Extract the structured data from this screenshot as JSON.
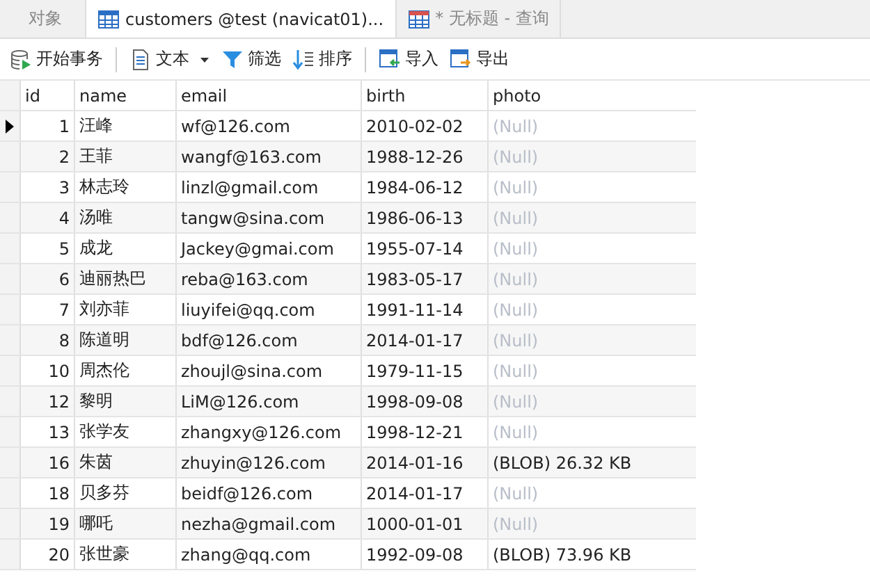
{
  "tabs": [
    {
      "label": "对象",
      "kind": "plain",
      "selected": false
    },
    {
      "label": "customers @test (navicat01)...",
      "kind": "table",
      "selected": true
    },
    {
      "label": "* 无标题 - 查询",
      "kind": "query",
      "selected": false
    }
  ],
  "toolbar": [
    {
      "label": "开始事务",
      "kind": "transaction",
      "dropdown": false
    },
    {
      "label": "文本",
      "kind": "text",
      "dropdown": true
    },
    {
      "label": "筛选",
      "kind": "filter",
      "dropdown": false
    },
    {
      "label": "排序",
      "kind": "sort",
      "dropdown": false
    },
    {
      "label": "导入",
      "kind": "import",
      "dropdown": false
    },
    {
      "label": "导出",
      "kind": "export",
      "dropdown": false
    }
  ],
  "table": {
    "columns": [
      "id",
      "name",
      "email",
      "birth",
      "photo"
    ],
    "rows": [
      {
        "selected": true,
        "cells": [
          "1",
          "汪峰",
          "wf@126.com",
          "2010-02-02",
          "(Null)"
        ],
        "photo_null": true
      },
      {
        "selected": false,
        "cells": [
          "2",
          "王菲",
          "wangf@163.com",
          "1988-12-26",
          "(Null)"
        ],
        "photo_null": true
      },
      {
        "selected": false,
        "cells": [
          "3",
          "林志玲",
          "linzl@gmail.com",
          "1984-06-12",
          "(Null)"
        ],
        "photo_null": true
      },
      {
        "selected": false,
        "cells": [
          "4",
          "汤唯",
          "tangw@sina.com",
          "1986-06-13",
          "(Null)"
        ],
        "photo_null": true
      },
      {
        "selected": false,
        "cells": [
          "5",
          "成龙",
          "Jackey@gmai.com",
          "1955-07-14",
          "(Null)"
        ],
        "photo_null": true
      },
      {
        "selected": false,
        "cells": [
          "6",
          "迪丽热巴",
          "reba@163.com",
          "1983-05-17",
          "(Null)"
        ],
        "photo_null": true
      },
      {
        "selected": false,
        "cells": [
          "7",
          "刘亦菲",
          "liuyifei@qq.com",
          "1991-11-14",
          "(Null)"
        ],
        "photo_null": true
      },
      {
        "selected": false,
        "cells": [
          "8",
          "陈道明",
          "bdf@126.com",
          "2014-01-17",
          "(Null)"
        ],
        "photo_null": true
      },
      {
        "selected": false,
        "cells": [
          "10",
          "周杰伦",
          "zhoujl@sina.com",
          "1979-11-15",
          "(Null)"
        ],
        "photo_null": true
      },
      {
        "selected": false,
        "cells": [
          "12",
          "黎明",
          "LiM@126.com",
          "1998-09-08",
          "(Null)"
        ],
        "photo_null": true
      },
      {
        "selected": false,
        "cells": [
          "13",
          "张学友",
          "zhangxy@126.com",
          "1998-12-21",
          "(Null)"
        ],
        "photo_null": true
      },
      {
        "selected": false,
        "cells": [
          "16",
          "朱茵",
          "zhuyin@126.com",
          "2014-01-16",
          "(BLOB) 26.32 KB"
        ],
        "photo_null": false
      },
      {
        "selected": false,
        "cells": [
          "18",
          "贝多芬",
          "beidf@126.com",
          "2014-01-17",
          "(Null)"
        ],
        "photo_null": true
      },
      {
        "selected": false,
        "cells": [
          "19",
          "哪吒",
          "nezha@gmail.com",
          "1000-01-01",
          "(Null)"
        ],
        "photo_null": true
      },
      {
        "selected": false,
        "cells": [
          "20",
          "张世豪",
          "zhang@qq.com",
          "1992-09-08",
          "(BLOB) 73.96 KB"
        ],
        "photo_null": false
      }
    ]
  }
}
